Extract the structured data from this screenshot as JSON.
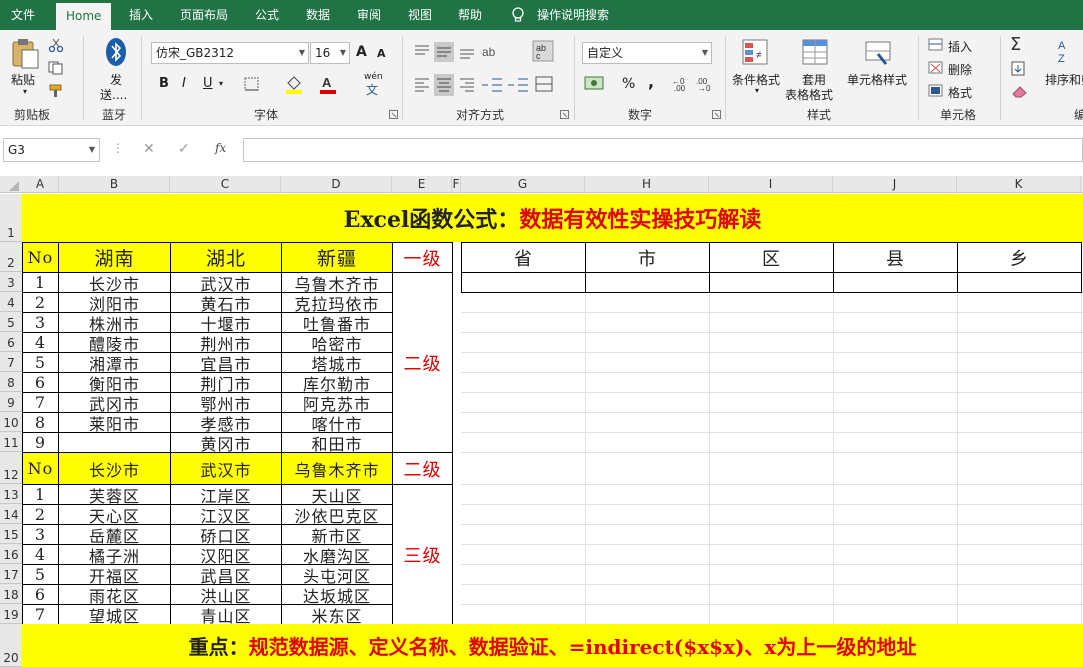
{
  "tabs": [
    "文件",
    "Home",
    "插入",
    "页面布局",
    "公式",
    "数据",
    "审阅",
    "视图",
    "帮助",
    "操作说明搜索"
  ],
  "ribbon": {
    "clipboard": {
      "paste": "粘贴",
      "group": "剪贴板"
    },
    "bluetooth": {
      "send": "发",
      "send2": "送....",
      "group": "蓝牙"
    },
    "font": {
      "name": "仿宋_GB2312",
      "size": "16",
      "group": "字体",
      "bold": "B",
      "italic": "I",
      "underline": "U",
      "grow": "A",
      "shrink": "A",
      "phonetic": "wén",
      "phonetic2": "文",
      "fontcolor": "A"
    },
    "align": {
      "group": "对齐方式"
    },
    "number": {
      "format": "自定义",
      "group": "数字",
      "percent": "%",
      "comma": ","
    },
    "styles": {
      "cond": "条件格式",
      "table": "套用",
      "table2": "表格格式",
      "cell": "单元格样式",
      "group": "样式"
    },
    "cells": {
      "insert": "插入",
      "delete": "删除",
      "format": "格式",
      "group": "单元格"
    },
    "edit": {
      "sort": "排序和筛",
      "group": "编"
    }
  },
  "formula_bar": {
    "cell_ref": "G3",
    "fx": "fx",
    "value": ""
  },
  "columns": [
    "A",
    "B",
    "C",
    "D",
    "E",
    "F",
    "G",
    "H",
    "I",
    "J",
    "K"
  ],
  "rows": [
    "1",
    "2",
    "3",
    "4",
    "5",
    "6",
    "7",
    "8",
    "9",
    "10",
    "11",
    "12",
    "13",
    "14",
    "15",
    "16",
    "17",
    "18",
    "19",
    "20"
  ],
  "sheet": {
    "title_black": "Excel函数公式：",
    "title_red": "数据有效性实操技巧解读",
    "header": {
      "no": "No",
      "b": "湖南",
      "c": "湖北",
      "d": "新疆",
      "e": "一级"
    },
    "level1_rows": [
      {
        "no": "1",
        "b": "长沙市",
        "c": "武汉市",
        "d": "乌鲁木齐市"
      },
      {
        "no": "2",
        "b": "浏阳市",
        "c": "黄石市",
        "d": "克拉玛依市"
      },
      {
        "no": "3",
        "b": "株洲市",
        "c": "十堰市",
        "d": "吐鲁番市"
      },
      {
        "no": "4",
        "b": "醴陵市",
        "c": "荆州市",
        "d": "哈密市"
      },
      {
        "no": "5",
        "b": "湘潭市",
        "c": "宜昌市",
        "d": "塔城市"
      },
      {
        "no": "6",
        "b": "衡阳市",
        "c": "荆门市",
        "d": "库尔勒市"
      },
      {
        "no": "7",
        "b": "武冈市",
        "c": "鄂州市",
        "d": "阿克苏市"
      },
      {
        "no": "8",
        "b": "莱阳市",
        "c": "孝感市",
        "d": "喀什市"
      },
      {
        "no": "9",
        "b": "",
        "c": "黄冈市",
        "d": "和田市"
      }
    ],
    "level2_label": "二级",
    "header2": {
      "no": "No",
      "b": "长沙市",
      "c": "武汉市",
      "d": "乌鲁木齐市",
      "e": "二级"
    },
    "level2_rows": [
      {
        "no": "1",
        "b": "芙蓉区",
        "c": "江岸区",
        "d": "天山区"
      },
      {
        "no": "2",
        "b": "天心区",
        "c": "江汉区",
        "d": "沙依巴克区"
      },
      {
        "no": "3",
        "b": "岳麓区",
        "c": "硚口区",
        "d": "新市区"
      },
      {
        "no": "4",
        "b": "橘子洲",
        "c": "汉阳区",
        "d": "水磨沟区"
      },
      {
        "no": "5",
        "b": "开福区",
        "c": "武昌区",
        "d": "头屯河区"
      },
      {
        "no": "6",
        "b": "雨花区",
        "c": "洪山区",
        "d": "达坂城区"
      },
      {
        "no": "7",
        "b": "望城区",
        "c": "青山区",
        "d": "米东区"
      }
    ],
    "level3_label": "三级",
    "input_headers": [
      "省",
      "市",
      "区",
      "县",
      "乡"
    ],
    "footer_black": "重点：",
    "footer_red": "规范数据源、定义名称、数据验证、=indirect($x$x)、x为上一级的地址"
  },
  "colors": {
    "excel_green": "#217346",
    "highlight": "#ffff00",
    "accent_red": "#e00000"
  }
}
